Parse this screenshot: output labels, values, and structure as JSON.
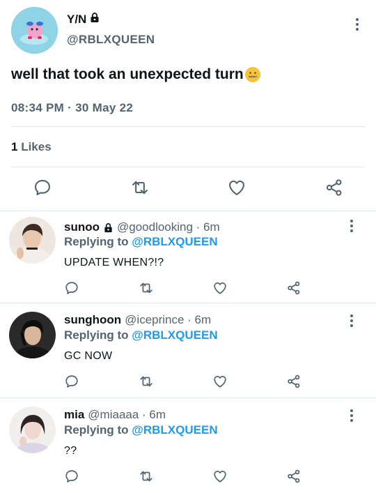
{
  "main_tweet": {
    "display_name": "Y/N",
    "handle": "@RBLXQUEEN",
    "text": "well that took an unexpected turn",
    "emoji_icon": "zipper-mouth-face",
    "timestamp": "08:34 PM · 30 May 22",
    "likes_count": "1",
    "likes_label": "Likes"
  },
  "replies": [
    {
      "name": "sunoo",
      "locked": true,
      "handle": "@goodlooking · 6m",
      "replying_prefix": "Replying to",
      "replying_to": "@RBLXQUEEN",
      "text": "UPDATE WHEN?!?"
    },
    {
      "name": "sunghoon",
      "locked": false,
      "handle": "@iceprince · 6m",
      "replying_prefix": "Replying to",
      "replying_to": "@RBLXQUEEN",
      "text": "GC NOW"
    },
    {
      "name": "mia",
      "locked": false,
      "handle": "@miaaaa · 6m",
      "replying_prefix": "Replying to",
      "replying_to": "@RBLXQUEEN",
      "text": "??"
    }
  ],
  "icons": [
    "lock-icon",
    "more-icon",
    "reply-icon",
    "retweet-icon",
    "like-icon",
    "share-icon"
  ],
  "colors": {
    "text": "#0f1419",
    "muted": "#536471",
    "link": "#1d9bf0",
    "divider": "#e1e6ea"
  }
}
